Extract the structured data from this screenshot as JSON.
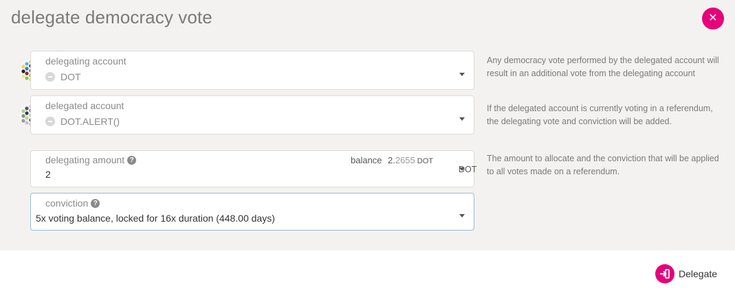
{
  "modal": {
    "title": "delegate democracy vote",
    "close_icon": "close-icon"
  },
  "delegating_account": {
    "label": "delegating account",
    "value": "DOT"
  },
  "delegated_account": {
    "label": "delegated account",
    "value": "DOT.ALERT()"
  },
  "delegating_amount": {
    "label": "delegating amount",
    "value": "2",
    "balance_label": "balance",
    "balance_int": "2.",
    "balance_dec": "2655",
    "balance_unit": "DOT",
    "unit": "DOT"
  },
  "conviction": {
    "label": "conviction",
    "value": "5x voting balance, locked for 16x duration (448.00 days)"
  },
  "descriptions": {
    "account": "Any democracy vote performed by the delegated account will result in an additional vote from the delegating account",
    "delegated": "If the delegated account is currently voting in a referendum, the delegating vote and conviction will be added.",
    "amount": "The amount to allocate and the conviction that will be applied to all votes made on a referendum."
  },
  "footer": {
    "delegate_label": "Delegate"
  },
  "colors": {
    "accent": "#e6007a",
    "background": "#f3f2f1"
  }
}
